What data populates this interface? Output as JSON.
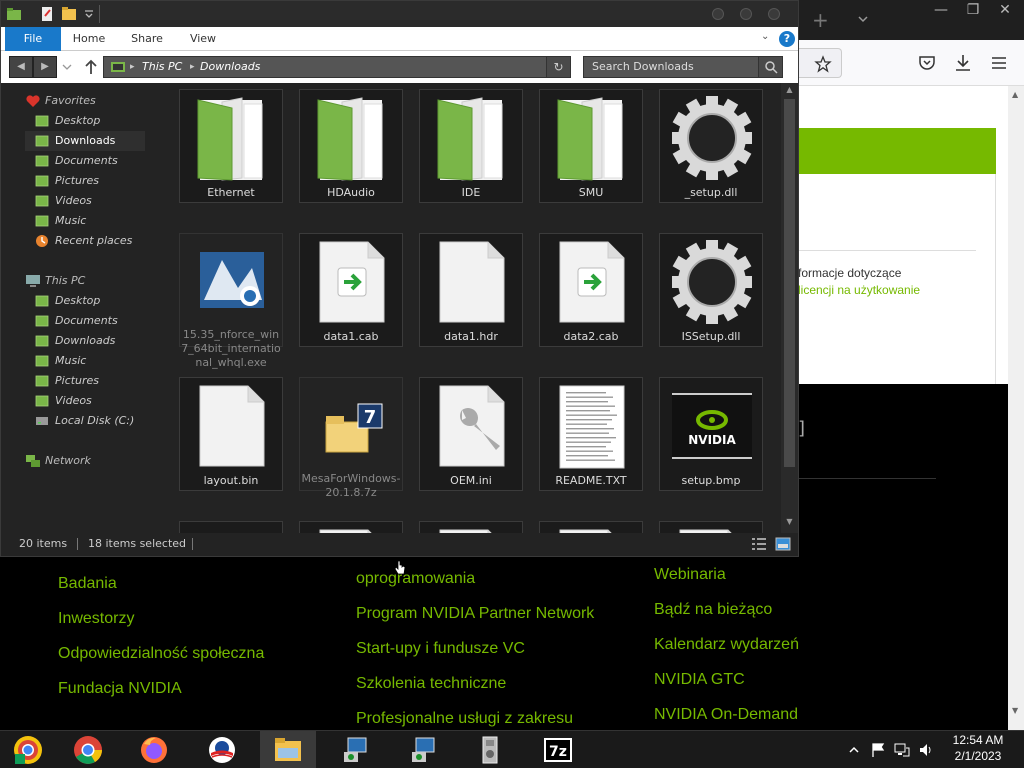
{
  "window": {
    "ribbon_tabs": [
      "File",
      "Home",
      "Share",
      "View"
    ],
    "help": "?",
    "address": [
      "This PC",
      "Downloads"
    ],
    "search_placeholder": "Search Downloads"
  },
  "sidebar": {
    "favorites_label": "Favorites",
    "favorites": [
      "Desktop",
      "Downloads",
      "Documents",
      "Pictures",
      "Videos",
      "Music",
      "Recent places"
    ],
    "this_pc_label": "This PC",
    "this_pc": [
      "Desktop",
      "Documents",
      "Downloads",
      "Music",
      "Pictures",
      "Videos",
      "Local Disk (C:)"
    ],
    "network_label": "Network"
  },
  "files": [
    {
      "name": "Ethernet",
      "type": "folder",
      "selected": true
    },
    {
      "name": "HDAudio",
      "type": "folder",
      "selected": true
    },
    {
      "name": "IDE",
      "type": "folder",
      "selected": true
    },
    {
      "name": "SMU",
      "type": "folder",
      "selected": true
    },
    {
      "name": "_setup.dll",
      "type": "gear",
      "selected": true
    },
    {
      "name": "15.35_nforce_win7_64bit_international_whql.exe",
      "type": "installer",
      "selected": false
    },
    {
      "name": "data1.cab",
      "type": "cab",
      "selected": true
    },
    {
      "name": "data1.hdr",
      "type": "blank",
      "selected": true
    },
    {
      "name": "data2.cab",
      "type": "cab",
      "selected": true
    },
    {
      "name": "ISSetup.dll",
      "type": "gear",
      "selected": true
    },
    {
      "name": "layout.bin",
      "type": "blank",
      "selected": true
    },
    {
      "name": "MesaForWindows-20.1.8.7z",
      "type": "sevenzip",
      "selected": false
    },
    {
      "name": "OEM.ini",
      "type": "wrench",
      "selected": true
    },
    {
      "name": "README.TXT",
      "type": "text",
      "selected": true
    },
    {
      "name": "setup.bmp",
      "type": "nvidia",
      "selected": true
    },
    {
      "name": "",
      "type": "installer",
      "selected": true
    },
    {
      "name": "",
      "type": "wrench",
      "selected": true
    },
    {
      "name": "",
      "type": "blank",
      "selected": true
    },
    {
      "name": "",
      "type": "blank",
      "selected": true
    },
    {
      "name": "",
      "type": "blank",
      "selected": true
    }
  ],
  "status": {
    "items": "20 items",
    "selected": "18 items selected"
  },
  "browser": {
    "text_line1": "formacje dotyczące",
    "text_line2": "licencji na użytkowanie",
    "footer_col1": [
      "Badania",
      "Inwestorzy",
      "Odpowiedzialność społeczna",
      "Fundacja NVIDIA"
    ],
    "footer_col2": [
      "oprogramowania",
      "Program NVIDIA Partner Network",
      "Start-upy i fundusze VC",
      "Szkolenia techniczne",
      "Profesjonalne usługi z zakresu"
    ],
    "footer_col3": [
      "Webinaria",
      "Bądź na bieżąco",
      "Kalendarz wydarzeń",
      "NVIDIA GTC",
      "NVIDIA On-Demand"
    ],
    "link_color": "#76b900"
  },
  "taskbar": {
    "apps": [
      "chrome-yellow-icon",
      "chrome-icon",
      "firefox-icon",
      "obama-logo-icon",
      "file-explorer-icon",
      "installer-icon",
      "installer-icon",
      "setup-icon",
      "7zip-icon"
    ],
    "time": "12:54 AM",
    "date": "2/1/2023"
  },
  "colors": {
    "accent": "#1979ca",
    "folder_green": "#7ab648",
    "nvidia_green": "#76b900"
  }
}
